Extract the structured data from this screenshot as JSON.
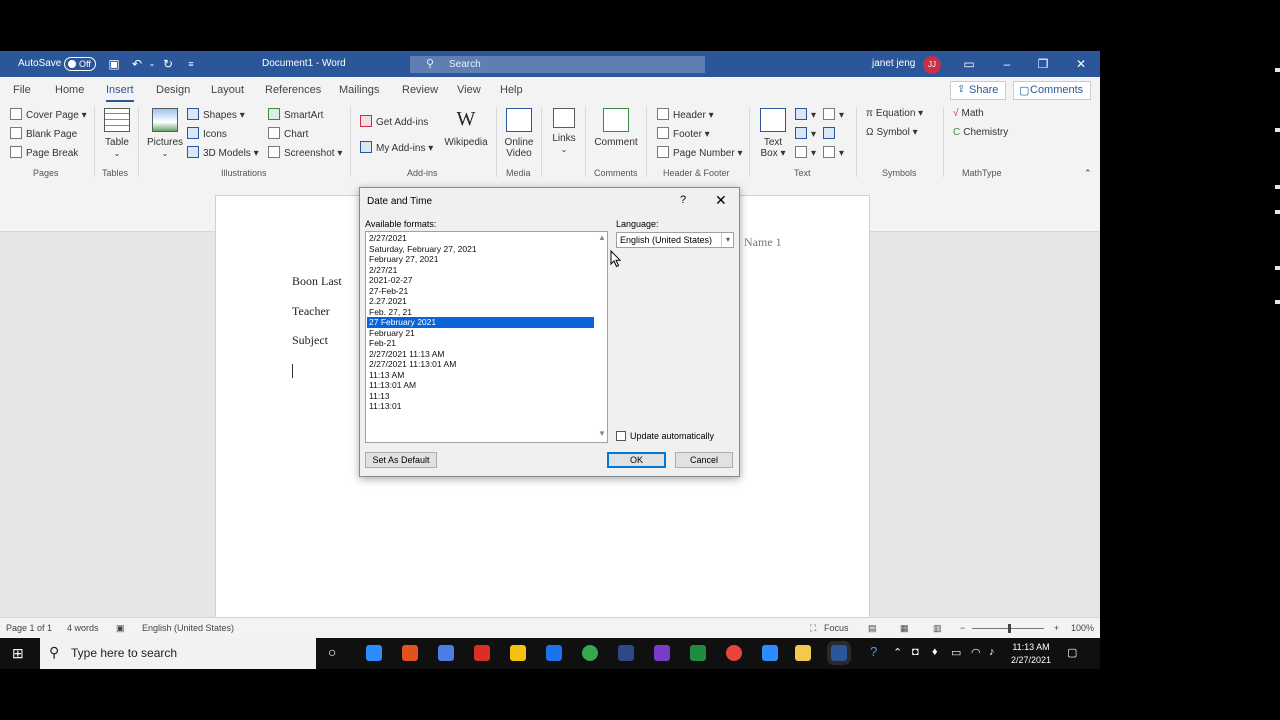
{
  "titlebar": {
    "autosave_label": "AutoSave",
    "autosave_state": "Off",
    "document_title": "Document1  -  Word",
    "search_placeholder": "Search",
    "user_name": "janet jeng",
    "user_initials": "JJ"
  },
  "tabs": [
    "File",
    "Home",
    "Insert",
    "Design",
    "Layout",
    "References",
    "Mailings",
    "Review",
    "View",
    "Help"
  ],
  "active_tab": "Insert",
  "share_label": "Share",
  "comments_label": "Comments",
  "ribbon": {
    "pages": {
      "cover_page": "Cover Page",
      "blank_page": "Blank Page",
      "page_break": "Page Break",
      "group": "Pages"
    },
    "tables": {
      "table": "Table",
      "group": "Tables"
    },
    "illustrations": {
      "pictures": "Pictures",
      "shapes": "Shapes",
      "icons": "Icons",
      "models": "3D Models",
      "smartart": "SmartArt",
      "chart": "Chart",
      "screenshot": "Screenshot",
      "group": "Illustrations"
    },
    "addins": {
      "get_addins": "Get Add-ins",
      "my_addins": "My Add-ins",
      "wikipedia": "Wikipedia",
      "group": "Add-ins"
    },
    "media": {
      "online_video_1": "Online",
      "online_video_2": "Video",
      "group": "Media"
    },
    "links": {
      "links": "Links"
    },
    "comments": {
      "comment": "Comment",
      "group": "Comments"
    },
    "header_footer": {
      "header": "Header",
      "footer": "Footer",
      "page_number": "Page Number",
      "group": "Header & Footer"
    },
    "text": {
      "text_box_1": "Text",
      "text_box_2": "Box",
      "group": "Text"
    },
    "symbols": {
      "equation": "Equation",
      "symbol": "Symbol",
      "group": "Symbols"
    },
    "mathtype": {
      "math": "Math",
      "chemistry": "Chemistry",
      "group": "MathType"
    }
  },
  "document": {
    "lines": [
      "Boon Last",
      "Teacher",
      "Subject"
    ],
    "header_text": "Name   1"
  },
  "dialog": {
    "title": "Date and Time",
    "help": "?",
    "available_formats_label": "Available formats:",
    "language_label": "Language:",
    "language_value": "English (United States)",
    "formats": [
      "2/27/2021",
      "Saturday, February 27, 2021",
      "February 27, 2021",
      "2/27/21",
      "2021-02-27",
      "27-Feb-21",
      "2.27.2021",
      "Feb. 27, 21",
      "27 February 2021",
      "February 21",
      "Feb-21",
      "2/27/2021 11:13 AM",
      "2/27/2021 11:13:01 AM",
      "11:13 AM",
      "11:13:01 AM",
      "11:13",
      "11:13:01"
    ],
    "selected_format": "27 February 2021",
    "update_automatically_label": "Update automatically",
    "update_automatically": false,
    "set_default_label": "Set As Default",
    "ok_label": "OK",
    "cancel_label": "Cancel"
  },
  "statusbar": {
    "page": "Page 1 of 1",
    "words": "4 words",
    "language": "English (United States)",
    "focus": "Focus",
    "zoom": "100%"
  },
  "taskbar": {
    "search_placeholder": "Type here to search",
    "time": "11:13 AM",
    "date": "2/27/2021"
  },
  "colors": {
    "word_blue": "#2b579a",
    "selection": "#0a64d6",
    "avatar": "#c4314b"
  }
}
